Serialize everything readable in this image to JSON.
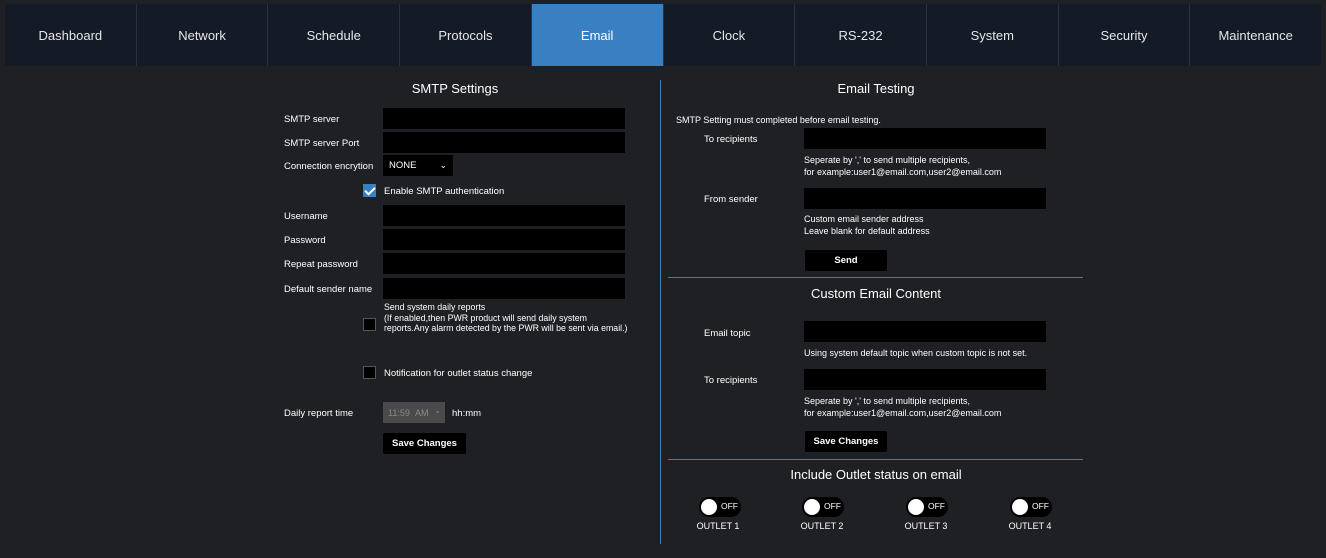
{
  "nav": {
    "tabs": [
      "Dashboard",
      "Network",
      "Schedule",
      "Protocols",
      "Email",
      "Clock",
      "RS-232",
      "System",
      "Security",
      "Maintenance"
    ],
    "active": "Email"
  },
  "smtp": {
    "title": "SMTP Settings",
    "server_label": "SMTP server",
    "server_value": "",
    "port_label": "SMTP server Port",
    "port_value": "",
    "encryption_label": "Connection encrytion",
    "encryption_value": "NONE",
    "auth_label": "Enable SMTP authentication",
    "auth_checked": true,
    "username_label": "Username",
    "password_label": "Password",
    "repeat_password_label": "Repeat password",
    "sender_name_label": "Default sender name",
    "daily_reports_text": "Send system daily reports\n(If enabled,then PWR product will send daily system reports.Any alarm detected by the PWR will be sent via email.)",
    "daily_reports_checked": false,
    "outlet_notify_label": "Notification for outlet status change",
    "outlet_notify_checked": false,
    "daily_time_label": "Daily report time",
    "daily_time_value": "11:59",
    "daily_ampm_value": "AM",
    "time_format": "hh:mm",
    "save_label": "Save Changes"
  },
  "email_testing": {
    "title": "Email Testing",
    "intro": "SMTP Setting must completed before email testing.",
    "to_label": "To recipients",
    "to_note": "Seperate by ',' to send multiple recipients,\nfor example:user1@email.com,user2@email.com",
    "from_label": "From sender",
    "from_note": "Custom email sender address\nLeave blank for default address",
    "send_label": "Send"
  },
  "custom_content": {
    "title": "Custom Email Content",
    "topic_label": "Email topic",
    "topic_note": "Using system default topic when custom topic is not set.",
    "to_label": "To recipients",
    "to_note": "Seperate by ',' to send multiple recipients,\nfor example:user1@email.com,user2@email.com",
    "save_label": "Save Changes"
  },
  "outlets": {
    "title": "Include Outlet status on email",
    "items": [
      {
        "label": "OUTLET 1",
        "state": "OFF"
      },
      {
        "label": "OUTLET 2",
        "state": "OFF"
      },
      {
        "label": "OUTLET 3",
        "state": "OFF"
      },
      {
        "label": "OUTLET 4",
        "state": "OFF"
      }
    ]
  },
  "colors": {
    "accent": "#3a7fc1",
    "background": "#1f2024",
    "nav_background": "#151a27",
    "field_background": "#000000"
  }
}
